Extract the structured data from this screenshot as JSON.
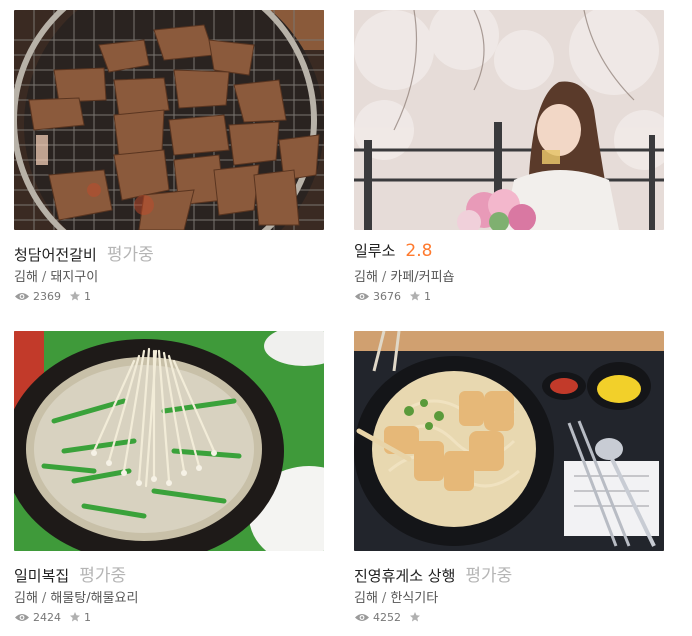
{
  "restaurants": [
    {
      "name": "청담어전갈비",
      "score": "평가중",
      "score_state": "pending",
      "region": "김해",
      "category": "돼지구이",
      "views": "2369",
      "stars": "1",
      "photo": "grilled-pork-on-grill"
    },
    {
      "name": "일루소",
      "score": "2.8",
      "score_state": "rated",
      "region": "김해",
      "category": "카페/커피숍",
      "views": "3676",
      "stars": "1",
      "photo": "woman-drinking-under-cherry-blossoms"
    },
    {
      "name": "일미복집",
      "score": "평가중",
      "score_state": "pending",
      "region": "김해",
      "category": "해물탕/해물요리",
      "views": "2424",
      "stars": "1",
      "photo": "pufferfish-soup-hotpot"
    },
    {
      "name": "진영휴게소 상행",
      "score": "평가중",
      "score_state": "pending",
      "region": "김해",
      "category": "한식기타",
      "views": "4252",
      "stars": "",
      "photo": "udon-tray"
    }
  ],
  "separator": "/",
  "colors": {
    "pending": "#b5b5b5",
    "rated": "#ff7a2e",
    "icon": "#9a9a9a"
  },
  "icons": {
    "views": "eye-icon",
    "stars": "star-icon"
  }
}
